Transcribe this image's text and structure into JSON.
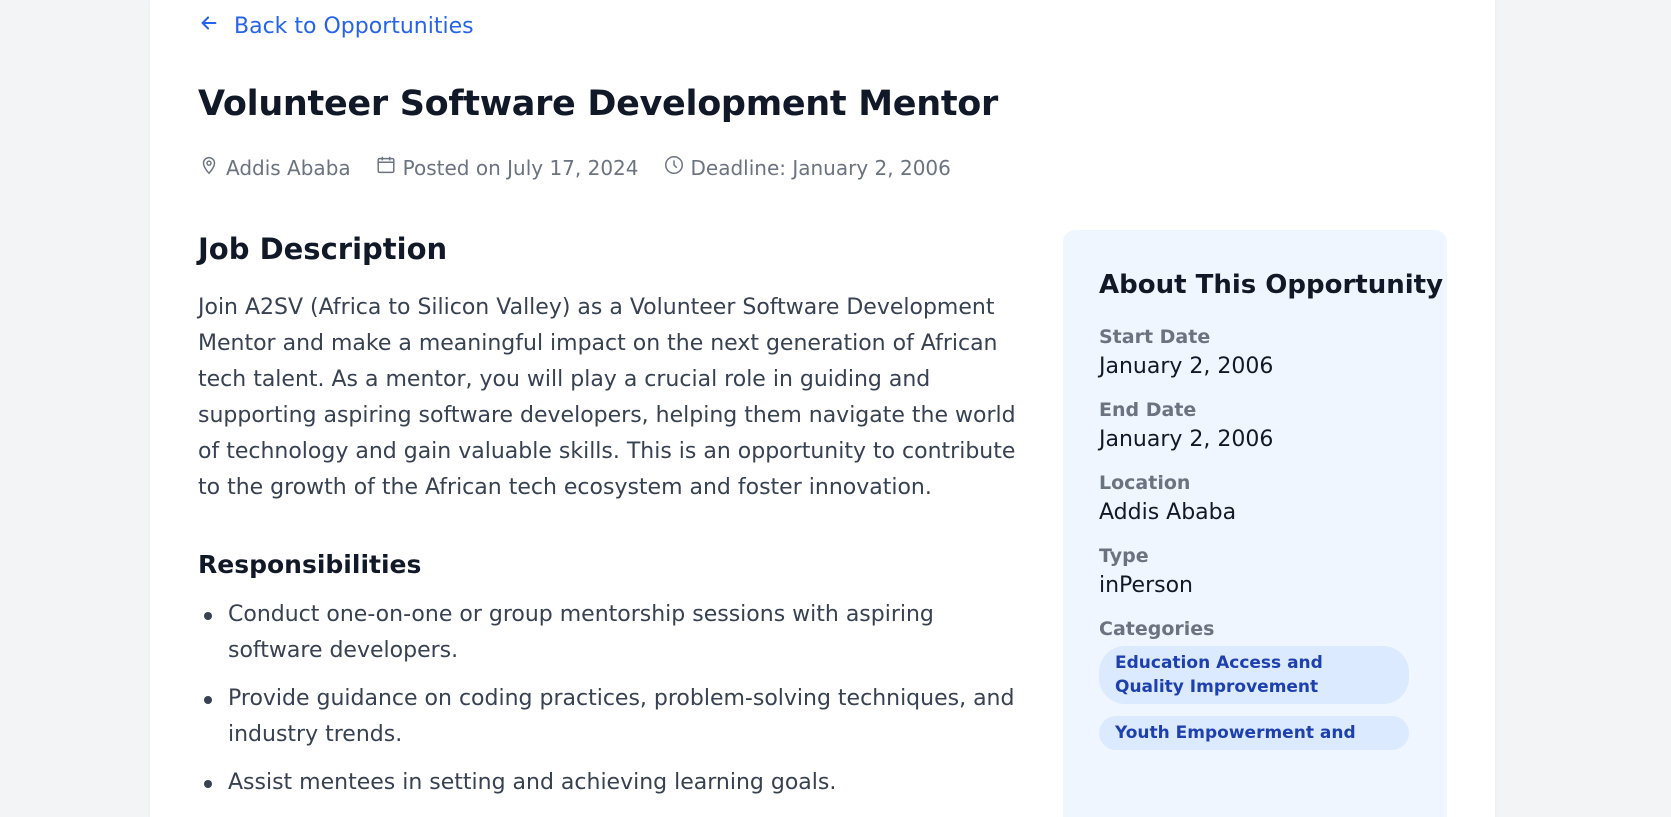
{
  "back_link": {
    "label": "Back to Opportunities",
    "icon": "arrow-left-icon"
  },
  "title": "Volunteer Software Development Mentor",
  "meta": {
    "location": "Addis Ababa",
    "posted": "Posted on July 17, 2024",
    "deadline": "Deadline: January 2, 2006"
  },
  "job_description": {
    "heading": "Job Description",
    "text": "Join A2SV (Africa to Silicon Valley) as a Volunteer Software Development Mentor and make a meaningful impact on the next generation of African tech talent. As a mentor, you will play a crucial role in guiding and supporting aspiring software developers, helping them navigate the world of technology and gain valuable skills. This is an opportunity to contribute to the growth of the African tech ecosystem and foster innovation."
  },
  "responsibilities": {
    "heading": "Responsibilities",
    "items": [
      "Conduct one-on-one or group mentorship sessions with aspiring software developers.",
      "Provide guidance on coding practices, problem-solving techniques, and industry trends.",
      "Assist mentees in setting and achieving learning goals."
    ]
  },
  "sidebar": {
    "title": "About This Opportunity",
    "start_date_label": "Start Date",
    "start_date": "January 2, 2006",
    "end_date_label": "End Date",
    "end_date": "January 2, 2006",
    "location_label": "Location",
    "location": "Addis Ababa",
    "type_label": "Type",
    "type": "inPerson",
    "categories_label": "Categories",
    "categories": [
      "Education Access and Quality Improvement",
      "Youth Empowerment and"
    ]
  },
  "colors": {
    "accent": "#2563eb",
    "sidebar_bg": "#eff6ff",
    "chip_bg": "#dbeafe",
    "chip_text": "#1e40af"
  }
}
